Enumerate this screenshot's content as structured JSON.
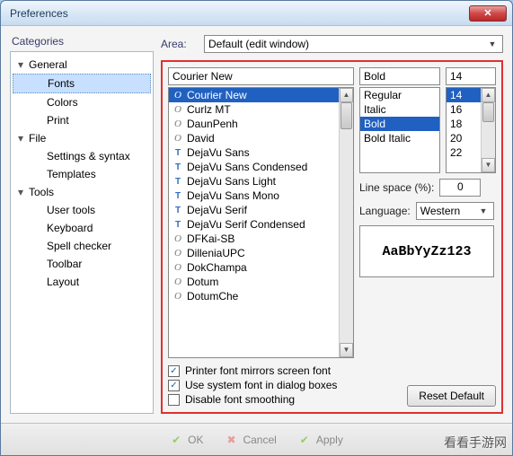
{
  "titlebar": {
    "title": "Preferences"
  },
  "sidebar": {
    "label": "Categories",
    "groups": [
      {
        "label": "General",
        "children": [
          "Fonts",
          "Colors",
          "Print"
        ]
      },
      {
        "label": "File",
        "children": [
          "Settings & syntax",
          "Templates"
        ]
      },
      {
        "label": "Tools",
        "children": [
          "User tools",
          "Keyboard",
          "Spell checker",
          "Toolbar",
          "Layout"
        ]
      }
    ],
    "selected": "Fonts"
  },
  "area": {
    "label": "Area:",
    "value": "Default (edit window)"
  },
  "font": {
    "name_value": "Courier New",
    "style_value": "Bold",
    "size_value": "14",
    "names": [
      {
        "t": "O",
        "n": "Courier New",
        "sel": true
      },
      {
        "t": "O",
        "n": "Curlz MT"
      },
      {
        "t": "O",
        "n": "DaunPenh"
      },
      {
        "t": "O",
        "n": "David"
      },
      {
        "t": "T",
        "n": "DejaVu Sans"
      },
      {
        "t": "T",
        "n": "DejaVu Sans Condensed"
      },
      {
        "t": "T",
        "n": "DejaVu Sans Light"
      },
      {
        "t": "T",
        "n": "DejaVu Sans Mono"
      },
      {
        "t": "T",
        "n": "DejaVu Serif"
      },
      {
        "t": "T",
        "n": "DejaVu Serif Condensed"
      },
      {
        "t": "O",
        "n": "DFKai-SB"
      },
      {
        "t": "O",
        "n": "DilleniaUPC"
      },
      {
        "t": "O",
        "n": "DokChampa"
      },
      {
        "t": "O",
        "n": "Dotum"
      },
      {
        "t": "O",
        "n": "DotumChe"
      }
    ],
    "styles": [
      "Regular",
      "Italic",
      "Bold",
      "Bold Italic"
    ],
    "style_selected": "Bold",
    "sizes": [
      "14",
      "16",
      "18",
      "20",
      "22"
    ],
    "size_selected": "14"
  },
  "linespace": {
    "label": "Line space (%):",
    "value": "0"
  },
  "language": {
    "label": "Language:",
    "value": "Western"
  },
  "preview": "AaBbYyZz123",
  "checks": {
    "printer": {
      "label": "Printer font mirrors screen font",
      "checked": true
    },
    "system": {
      "label": "Use system font in dialog boxes",
      "checked": true
    },
    "smooth": {
      "label": "Disable font smoothing",
      "checked": false
    }
  },
  "reset_label": "Reset Default",
  "footer": {
    "ok": "OK",
    "cancel": "Cancel",
    "apply": "Apply"
  },
  "watermark": "看看手游网"
}
